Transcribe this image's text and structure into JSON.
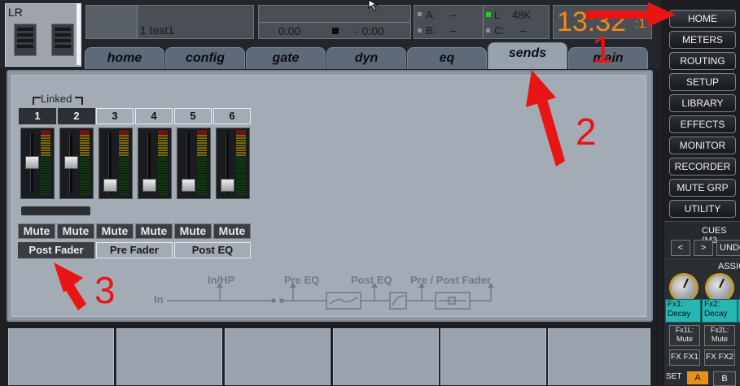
{
  "channel": {
    "label": "LR"
  },
  "display": {
    "scene": "1 test1",
    "time_elapsed": "0:00",
    "time_remaining": "- 0:00",
    "bus_a": "A:",
    "bus_a_val": "–",
    "bus_b": "B:",
    "bus_b_val": "–",
    "bus_l": "L",
    "bus_l_val": "48K",
    "bus_c": "C:",
    "bus_c_val": "–",
    "clock": "13:32",
    "clock_suffix": ":1"
  },
  "tabs": [
    "home",
    "config",
    "gate",
    "dyn",
    "eq",
    "sends",
    "main"
  ],
  "active_tab": "sends",
  "sends": {
    "linked_label": "Linked",
    "channels": [
      "1",
      "2",
      "3",
      "4",
      "5",
      "6"
    ],
    "selected_channels": [
      "1",
      "2"
    ],
    "fader_levels": [
      0.55,
      0.55,
      0.12,
      0.12,
      0.12,
      0.12
    ],
    "mute_label": "Mute",
    "taps": [
      "Post Fader",
      "Pre Fader",
      "Post EQ"
    ],
    "selected_tap": "Post Fader"
  },
  "signal_flow": {
    "in": "In",
    "in_hp": "In/HP",
    "pre_eq": "Pre EQ",
    "post_eq": "Post EQ",
    "pre_post_fader": "Pre / Post Fader"
  },
  "right_panel": {
    "buttons": [
      "HOME",
      "METERS",
      "ROUTING",
      "SETUP",
      "LIBRARY",
      "EFFECTS",
      "MONITOR",
      "RECORDER",
      "MUTE GRP",
      "UTILITY"
    ],
    "cues_label": "CUES (M3",
    "cue_prev": "<",
    "cue_next": ">",
    "undo": "UNDO",
    "assign_label": "ASSIG",
    "fx1_line1": "Fx1:",
    "fx1_line2": "Decay",
    "fx2_line1": "Fx2:",
    "fx2_line2": "Decay",
    "fx1l_line1": "Fx1L:",
    "fx1l_line2": "Mute",
    "fx2l_line1": "Fx2L:",
    "fx2l_line2": "Mute",
    "fxfx1": "FX FX1",
    "fxfx2": "FX FX2",
    "set_label": "SET",
    "set_a": "A",
    "set_b": "B"
  },
  "annotations": [
    "1",
    "2",
    "3"
  ],
  "colors": {
    "annotation": "#e91515",
    "clock": "#f08a1c",
    "fx_cell": "#29b5b3",
    "indicator_green": "#22d022"
  }
}
